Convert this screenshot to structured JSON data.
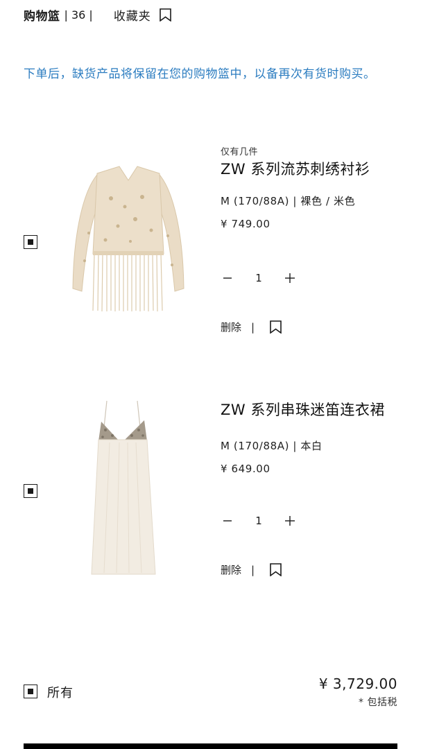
{
  "header": {
    "cart_label": "购物篮",
    "cart_count": "| 36 |",
    "favorites_label": "收藏夹"
  },
  "notice": "下单后，缺货产品将保留在您的购物篮中，以备再次有货时购买。",
  "products": [
    {
      "stock_note": "仅有几件",
      "name": "ZW 系列流苏刺绣衬衫",
      "variant": "M (170/88A) | 裸色 / 米色",
      "price": "¥ 749.00",
      "quantity": "1",
      "delete_label": "删除",
      "separator": "|",
      "image_colors": {
        "main": "#e9dcc8",
        "detail": "#d8c6a8"
      }
    },
    {
      "stock_note": "",
      "name": "ZW 系列串珠迷笛连衣裙",
      "variant": "M (170/88A) | 本白",
      "price": "¥ 649.00",
      "quantity": "1",
      "delete_label": "删除",
      "separator": "|",
      "image_colors": {
        "main": "#f1ebe1",
        "detail": "#9c9386"
      }
    }
  ],
  "footer": {
    "all_label": "所有",
    "total": "¥ 3,729.00",
    "tax_note": "* 包括税"
  },
  "icons": {
    "bookmark": "bookmark-icon",
    "minus": "minus-icon",
    "plus": "plus-icon",
    "checkbox": "checkbox-checked-icon"
  },
  "colors": {
    "notice": "#2b7cc0",
    "text": "#1a1a1a",
    "checkout_bar": "#000000"
  }
}
